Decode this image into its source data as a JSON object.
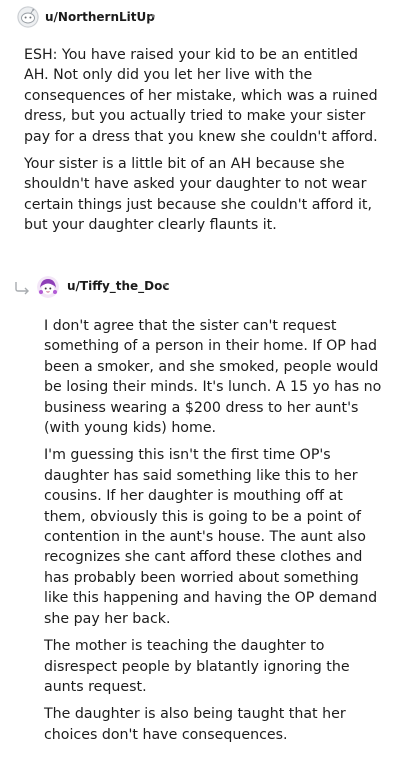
{
  "comments": [
    {
      "username": "u/NorthernLitUp",
      "separator": "•",
      "avatar_icon": "avatar-icon",
      "paragraphs": [
        "ESH: You have raised your kid to be an entitled AH. Not only did you let her live with the consequences of her mistake, which was a ruined dress, but you actually tried to make your sister pay for a dress that you knew she couldn't afford.",
        "Your sister is a little bit of an AH because she shouldn't have asked your daughter to not wear certain things just because she couldn't afford it, but your daughter clearly flaunts it."
      ]
    },
    {
      "username": "u/Tiffy_the_Doc",
      "separator": "•",
      "avatar_icon": "avatar-icon",
      "reply_icon": "reply-arrow-icon",
      "paragraphs": [
        "I don't agree that the sister can't request something of a person in their home. If OP had been a smoker, and she smoked, people would be losing their minds. It's lunch. A 15 yo has no business wearing a $200 dress to her aunt's (with young kids) home.",
        "I'm guessing this isn't the first time OP's daughter has said something like this to her cousins. If her daughter is mouthing off at them, obviously this is going to be a point of contention in the aunt's house. The aunt also recognizes she cant afford these clothes and has probably been worried about something like this happening and having the OP demand she pay her back.",
        "The mother is teaching the daughter to disrespect people by blatantly ignoring the aunts request.",
        "The daughter is also being taught that her choices don't have consequences."
      ]
    }
  ],
  "colors": {
    "text": "#1c1c1c",
    "meta": "#7c7c7c",
    "avatar_1": "#d7dadc",
    "avatar_2": "#b25bd6"
  }
}
